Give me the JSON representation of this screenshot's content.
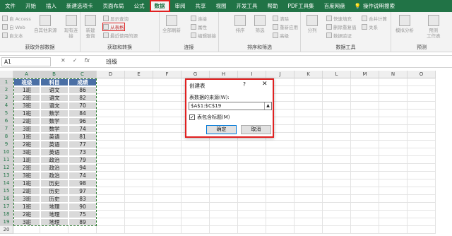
{
  "tabs": [
    "文件",
    "开始",
    "插入",
    "新建选项卡",
    "页面布局",
    "公式",
    "数据",
    "审阅",
    "共享",
    "视图",
    "开发工具",
    "帮助",
    "PDF工具集",
    "百度网盘"
  ],
  "active_tab": "数据",
  "tell_me": "操作说明搜索",
  "ribbon": {
    "external": {
      "label": "获取外部数据",
      "items": [
        "自 Access",
        "自 Web",
        "自文本",
        "自其他来源",
        "现有连接"
      ]
    },
    "transform": {
      "label": "获取和转换",
      "new_query": "新建\n查询",
      "items": [
        "显示查询",
        "从表格",
        "最近使用的源"
      ]
    },
    "connections": {
      "label": "连接",
      "refresh": "全部刷新",
      "items": [
        "连接",
        "属性",
        "编辑链接"
      ]
    },
    "sort": {
      "label": "排序和筛选",
      "items": [
        "排序",
        "筛选",
        "清除",
        "重新应用",
        "高级"
      ]
    },
    "tools": {
      "label": "数据工具",
      "items": [
        "分列",
        "快速填充",
        "删除重复值",
        "数据验证",
        "合并计算",
        "关系"
      ]
    },
    "forecast": {
      "label": "预测",
      "items": [
        "模拟分析",
        "预测\n工作表"
      ]
    }
  },
  "formula_bar": {
    "name_box": "A1",
    "value": "班级"
  },
  "columns": [
    "A",
    "B",
    "C",
    "D",
    "E",
    "F",
    "G",
    "H",
    "I",
    "J",
    "K",
    "L",
    "M",
    "N",
    "O"
  ],
  "rows": [
    "1",
    "2",
    "3",
    "4",
    "5",
    "6",
    "7",
    "8",
    "9",
    "10",
    "11",
    "12",
    "13",
    "14",
    "15",
    "16",
    "17",
    "18",
    "19",
    "20"
  ],
  "table": {
    "headers": [
      "班级",
      "科目",
      "成绩"
    ],
    "data": [
      [
        "1班",
        "语文",
        "86"
      ],
      [
        "2班",
        "语文",
        "82"
      ],
      [
        "3班",
        "语文",
        "70"
      ],
      [
        "1班",
        "数学",
        "84"
      ],
      [
        "2班",
        "数学",
        "96"
      ],
      [
        "3班",
        "数学",
        "74"
      ],
      [
        "1班",
        "英语",
        "81"
      ],
      [
        "2班",
        "英语",
        "77"
      ],
      [
        "3班",
        "英语",
        "73"
      ],
      [
        "1班",
        "政治",
        "79"
      ],
      [
        "2班",
        "政治",
        "94"
      ],
      [
        "3班",
        "政治",
        "74"
      ],
      [
        "1班",
        "历史",
        "98"
      ],
      [
        "2班",
        "历史",
        "97"
      ],
      [
        "3班",
        "历史",
        "83"
      ],
      [
        "1班",
        "地理",
        "90"
      ],
      [
        "2班",
        "地理",
        "75"
      ],
      [
        "3班",
        "地理",
        "89"
      ]
    ]
  },
  "dialog": {
    "title": "创建表",
    "help": "?",
    "close": "✕",
    "source_label": "表数据的来源(W):",
    "range": "$A$1:$C$19",
    "has_headers_label": "表包含标题(M)",
    "has_headers": true,
    "ok": "确定",
    "cancel": "取消"
  },
  "colors": {
    "accent": "#217346",
    "header_fill": "#4a6fa5",
    "data_fill": "#d9d9d9",
    "highlight": "#e02020"
  }
}
